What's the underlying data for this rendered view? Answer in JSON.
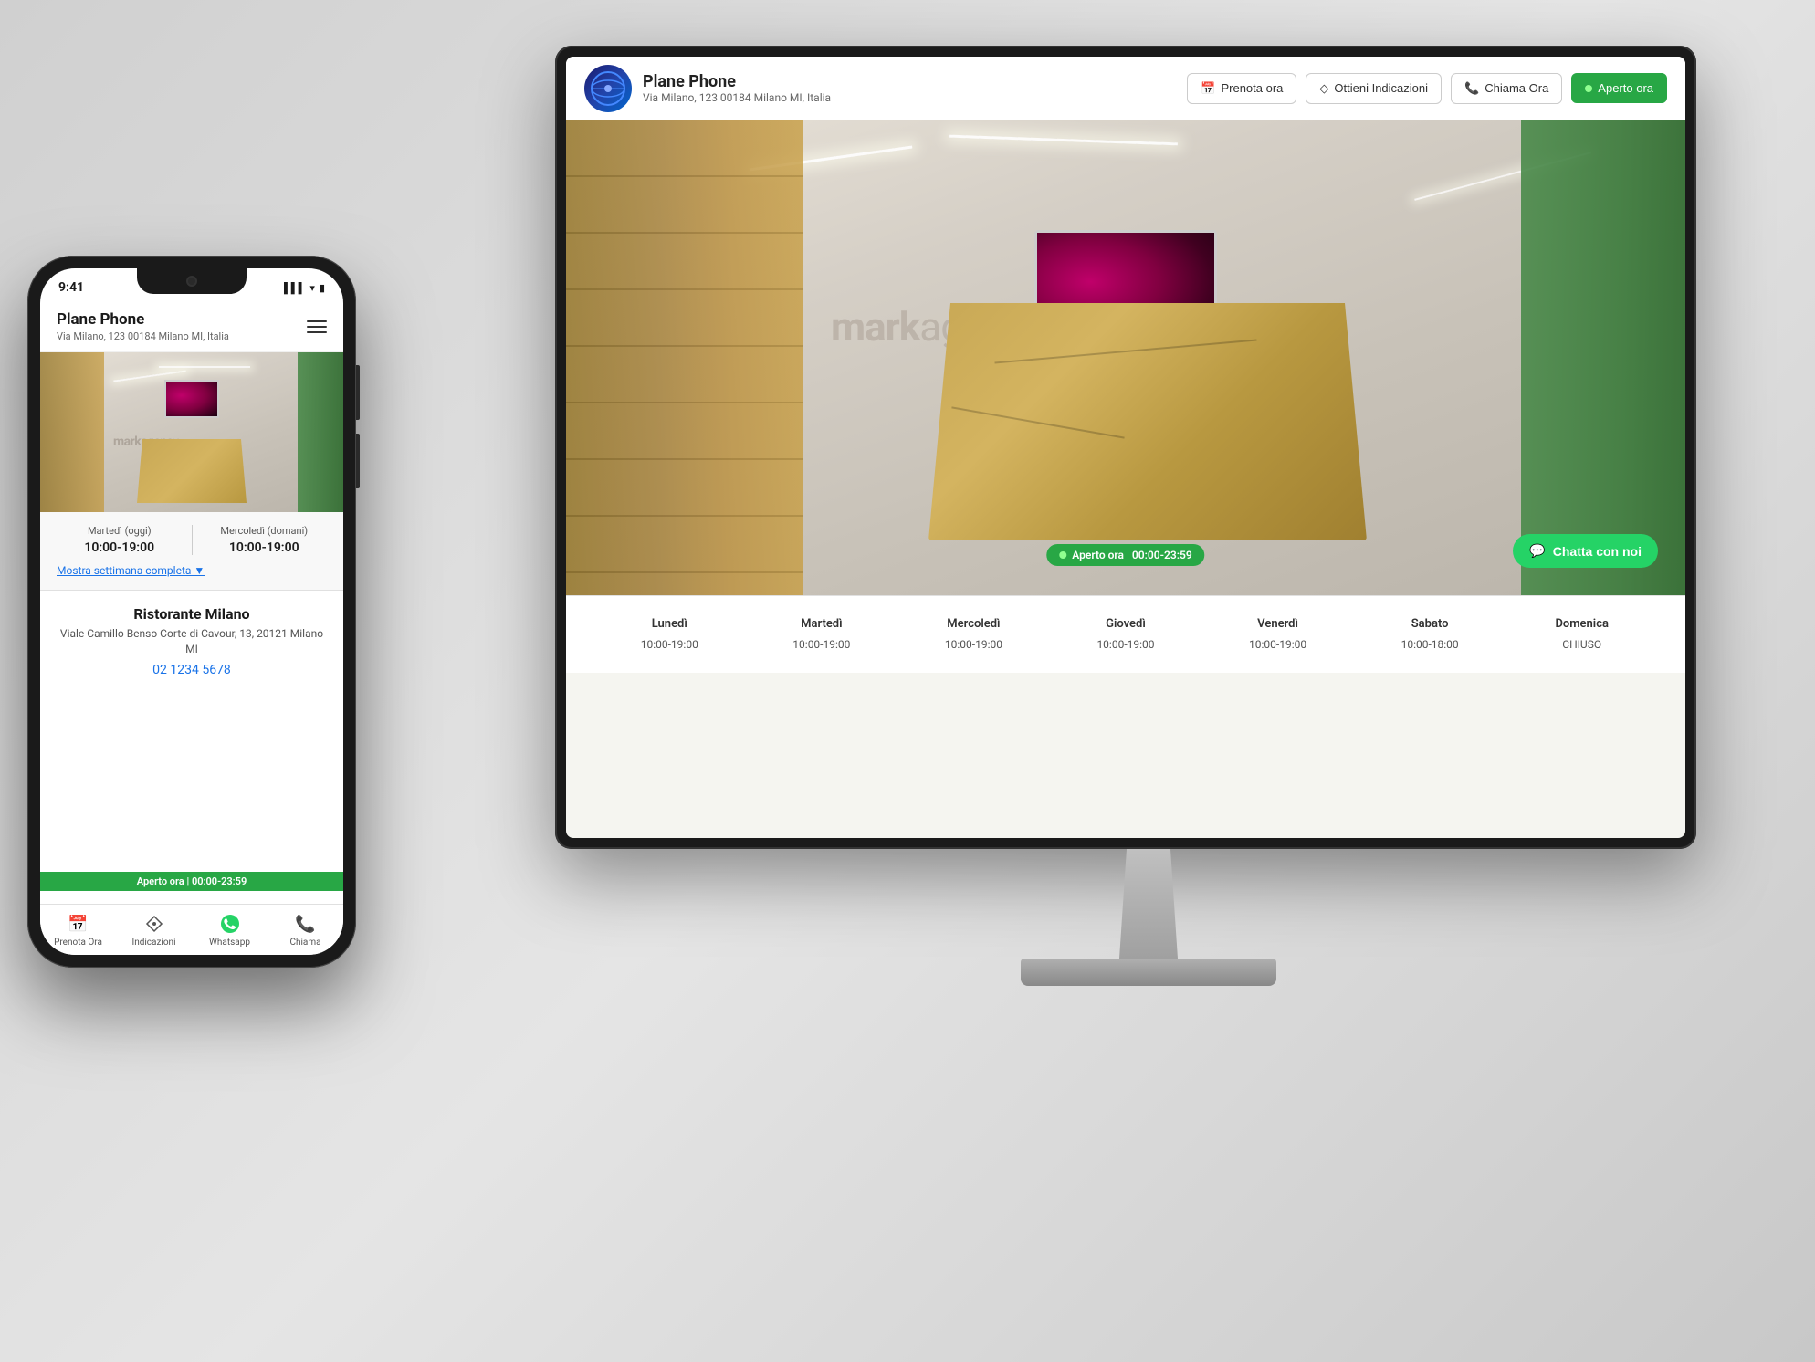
{
  "scene": {
    "bg_color": "#d8d8d8"
  },
  "desktop": {
    "header": {
      "business_name": "Plane Phone",
      "address": "Via Milano, 123 00184 Milano MI, Italia",
      "btn_prenota": "Prenota ora",
      "btn_indicazioni": "Ottieni Indicazioni",
      "btn_chiama": "Chiama Ora",
      "btn_aperto": "Aperto ora"
    },
    "store": {
      "logo_text_bold": "mark",
      "logo_text_light": "agency",
      "open_status": "Aperto ora | 00:00-23:59"
    },
    "hours": {
      "days": [
        {
          "name": "Lunedì",
          "time": "10:00-19:00"
        },
        {
          "name": "Martedì",
          "time": "10:00-19:00"
        },
        {
          "name": "Mercoledì",
          "time": "10:00-19:00"
        },
        {
          "name": "Giovedì",
          "time": "10:00-19:00"
        },
        {
          "name": "Venerdì",
          "time": "10:00-19:00"
        },
        {
          "name": "Sabato",
          "time": "10:00-18:00"
        },
        {
          "name": "Domenica",
          "time": "CHIUSO"
        }
      ]
    },
    "chat_btn": "Chatta con noi"
  },
  "mobile": {
    "status_bar": {
      "time": "9:41",
      "signals": "▲ ▼  ☰"
    },
    "header": {
      "business_name": "Plane Phone",
      "address": "Via Milano, 123 00184 Milano MI, Italia"
    },
    "hours": {
      "today_label": "Martedì (oggi)",
      "today_time": "10:00-19:00",
      "tomorrow_label": "Mercoledì (domani)",
      "tomorrow_time": "10:00-19:00",
      "show_week": "Mostra settimana completa ▼"
    },
    "restaurant": {
      "name": "Ristorante  Milano",
      "address": "Viale Camillo Benso Corte di Cavour, 13, 20121 Milano MI",
      "phone": "02 1234 5678"
    },
    "bottom_nav": [
      {
        "icon": "📅",
        "label": "Prenota Ora"
      },
      {
        "icon": "◇",
        "label": "Indicazioni"
      },
      {
        "icon": "💬",
        "label": "Whatsapp"
      },
      {
        "icon": "📞",
        "label": "Chiama"
      }
    ],
    "open_banner": "Aperto ora | 00:00-23:59"
  }
}
